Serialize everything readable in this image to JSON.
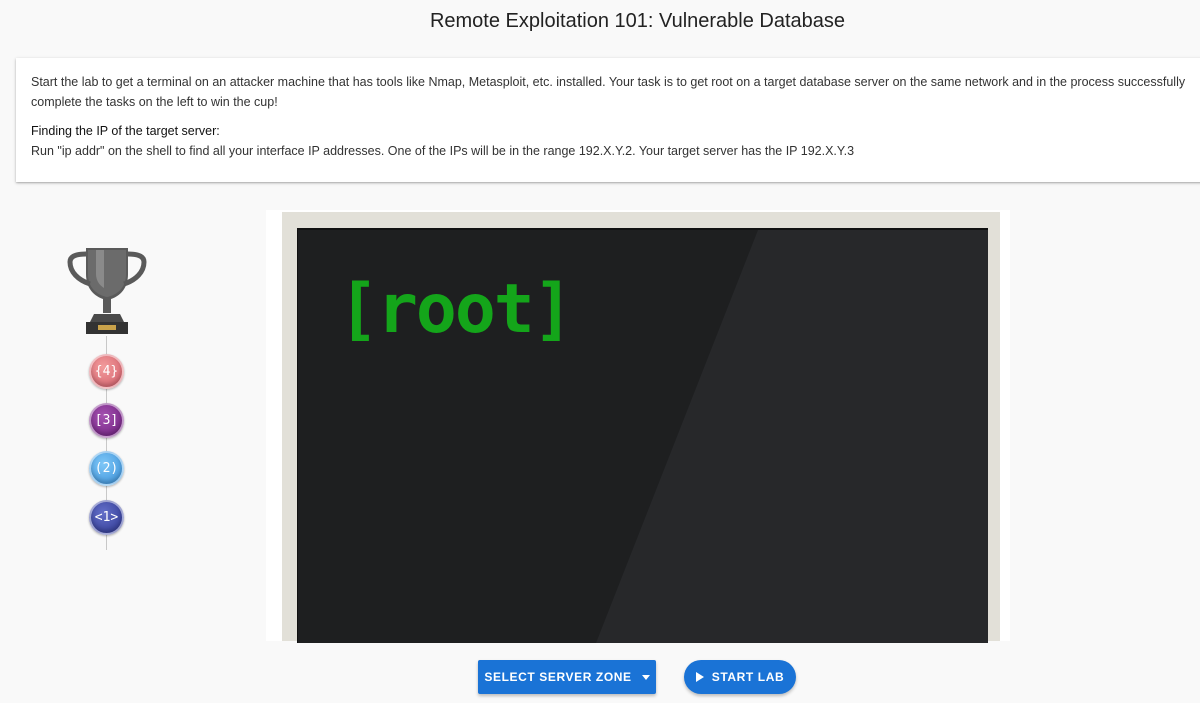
{
  "page": {
    "title": "Remote Exploitation 101: Vulnerable Database"
  },
  "info": {
    "description": "Start the lab to get a terminal on an attacker machine that has tools like Nmap, Metasploit, etc. installed. Your task is to get root on a target database server on the same network and in the process successfully complete the tasks on the left to win the cup!",
    "subheading": "Finding the IP of the target server:",
    "instructions": "Run \"ip addr\" on the shell to find all your interface IP addresses. One of the IPs will be in the range 192.X.Y.2. Your target server has the IP 192.X.Y.3"
  },
  "progress": {
    "trophy_icon": "trophy-icon",
    "tasks": [
      {
        "label": "{4}",
        "color": "#d35d6a"
      },
      {
        "label": "[3]",
        "color": "#6e1f7e"
      },
      {
        "label": "(2)",
        "color": "#3a8fd8"
      },
      {
        "label": "<1>",
        "color": "#2c358f"
      }
    ]
  },
  "terminal": {
    "text": "[root]",
    "text_color": "#14a51a"
  },
  "actions": {
    "select_zone_label": "SELECT SERVER ZONE",
    "start_lab_label": "START LAB",
    "accent_color": "#1a73d6"
  }
}
